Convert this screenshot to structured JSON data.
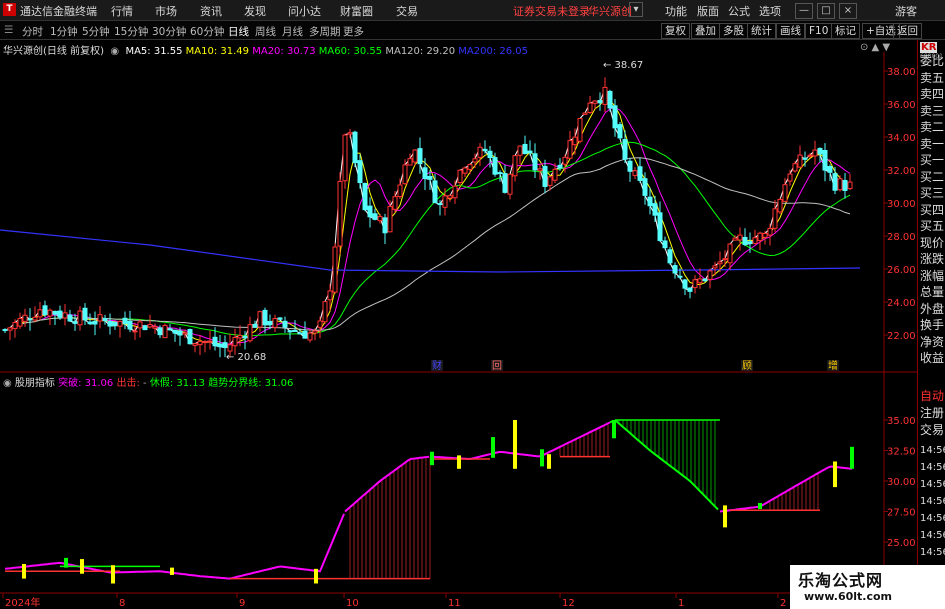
{
  "app": {
    "title": "通达信金融终端",
    "menu": [
      "行情",
      "市场",
      "资讯",
      "发现",
      "问小达",
      "财富圈",
      "交易"
    ],
    "status": "证券交易未登录",
    "stock_name": "华兴源创",
    "right_menu": [
      "功能",
      "版面",
      "公式",
      "选项"
    ],
    "user": "游客",
    "window_controls": [
      "—",
      "□",
      "×"
    ]
  },
  "toolbar": {
    "periods": [
      "分时",
      "1分钟",
      "5分钟",
      "15分钟",
      "30分钟",
      "60分钟",
      "日线",
      "周线",
      "月线",
      "多周期",
      "更多"
    ],
    "active_period": "日线",
    "buttons": [
      "复权",
      "叠加",
      "多股",
      "统计",
      "画线",
      "F10",
      "标记",
      "+自选",
      "返回"
    ]
  },
  "main_chart": {
    "header": "华兴源创(日线 前复权)",
    "ma": [
      {
        "label": "MA5: 31.55",
        "color": "#ffffff"
      },
      {
        "label": "MA10: 31.49",
        "color": "#ffff00"
      },
      {
        "label": "MA20: 30.73",
        "color": "#ff00ff"
      },
      {
        "label": "MA60: 30.55",
        "color": "#00ff00"
      },
      {
        "label": "MA120: 29.20",
        "color": "#c0c0c0"
      },
      {
        "label": "MA200: 26.05",
        "color": "#3333ff"
      }
    ],
    "y_ticks": [
      "38.00",
      "36.00",
      "34.00",
      "32.00",
      "30.00",
      "28.00",
      "26.00",
      "24.00",
      "22.00"
    ],
    "high_label": "38.67",
    "low_label": "20.68",
    "event_marks": [
      "财",
      "回",
      "顾",
      "增"
    ]
  },
  "sub_chart": {
    "name": "股朋指标",
    "items": [
      {
        "label": "突破: 31.06",
        "color": "#ff00ff"
      },
      {
        "label": "出击: ",
        "color": "#ff3030"
      },
      {
        "label": "休假: 31.13",
        "color": "#00ff00"
      },
      {
        "label": "趋势分界线: 31.06",
        "color": "#00ff00"
      }
    ],
    "y_ticks": [
      "35.00",
      "32.50",
      "30.00",
      "27.50",
      "25.00"
    ]
  },
  "x_axis": [
    "2024年",
    "8",
    "9",
    "10",
    "11",
    "12",
    "1",
    "2"
  ],
  "right_panel": {
    "code": "KR",
    "code_sub": "688001",
    "main_labels": [
      "委比",
      "卖五",
      "卖四",
      "卖三",
      "卖二",
      "卖一",
      "买一",
      "买二",
      "买三",
      "买四",
      "买五",
      "现价",
      "涨跌",
      "涨幅",
      "总量",
      "外盘",
      "换手",
      "净资",
      "收益"
    ],
    "sub_labels": [
      "自动",
      "注册",
      "交易"
    ],
    "times": [
      "14:56",
      "14:56",
      "14:56",
      "14:56",
      "14:56",
      "14:56",
      "14:56",
      "14:56"
    ]
  },
  "watermark": {
    "line1": "乐淘公式网",
    "line2": "www.60lt.com"
  },
  "colors": {
    "up": "#ff3232",
    "down": "#54fcfc",
    "background": "#000000",
    "grid": "#8b0000"
  }
}
